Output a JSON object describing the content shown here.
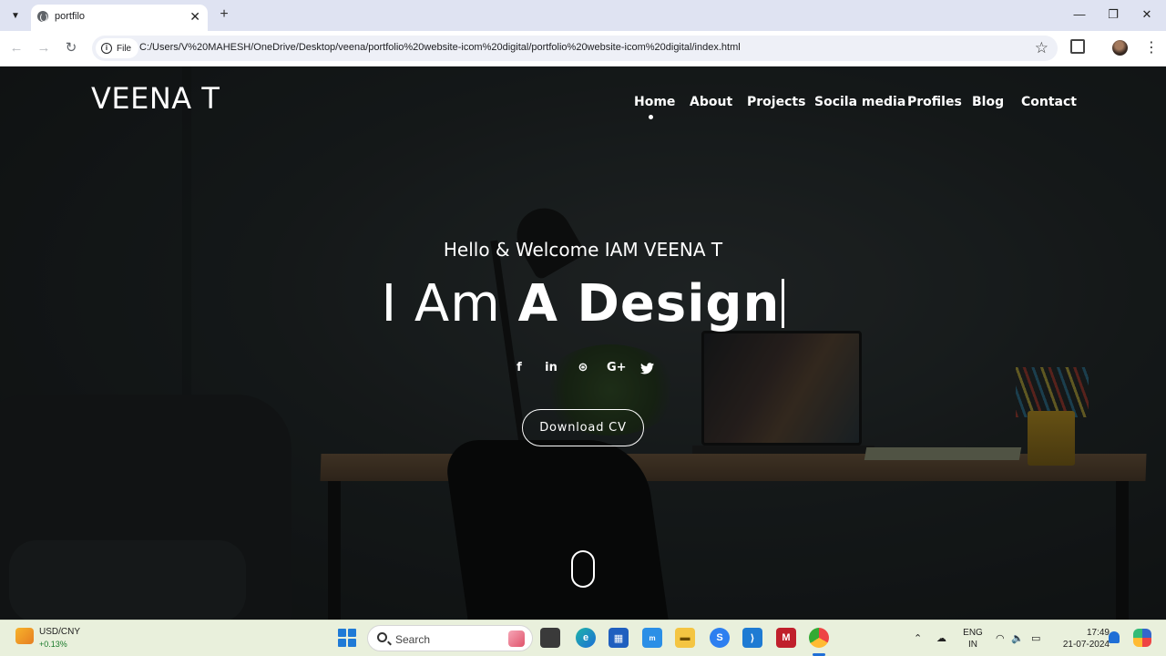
{
  "browser": {
    "tab": {
      "title": "portfilo",
      "icon": "globe-icon"
    },
    "address": {
      "chip_label": "File",
      "url": "C:/Users/V%20MAHESH/OneDrive/Desktop/veena/portfolio%20website-icom%20digital/portfolio%20website-icom%20digital/index.html"
    }
  },
  "site": {
    "brand": "VEENA T",
    "nav": [
      {
        "label": "Home",
        "active": true
      },
      {
        "label": "About"
      },
      {
        "label": "Projects"
      },
      {
        "label": "Socila media"
      },
      {
        "label": "Profiles"
      },
      {
        "label": "Blog"
      },
      {
        "label": "Contact"
      }
    ],
    "hero": {
      "subtitle": "Hello & Welcome IAM VEENA T",
      "title_prefix": "I Am ",
      "title_bold": "A Design"
    },
    "socials": [
      "facebook-icon",
      "linkedin-icon",
      "dribbble-icon",
      "google-plus-icon",
      "twitter-icon"
    ],
    "social_glyphs": {
      "facebook": "f",
      "linkedin": "in",
      "dribbble": "⊛",
      "google_plus": "G+",
      "twitter": "🐦"
    },
    "cta_label": "Download CV"
  },
  "taskbar": {
    "ticker": {
      "name": "USD/CNY",
      "change": "+0.13%"
    },
    "search_placeholder": "Search",
    "language": {
      "line1": "ENG",
      "line2": "IN"
    },
    "clock": {
      "time": "17:49",
      "date": "21-07-2024"
    }
  }
}
